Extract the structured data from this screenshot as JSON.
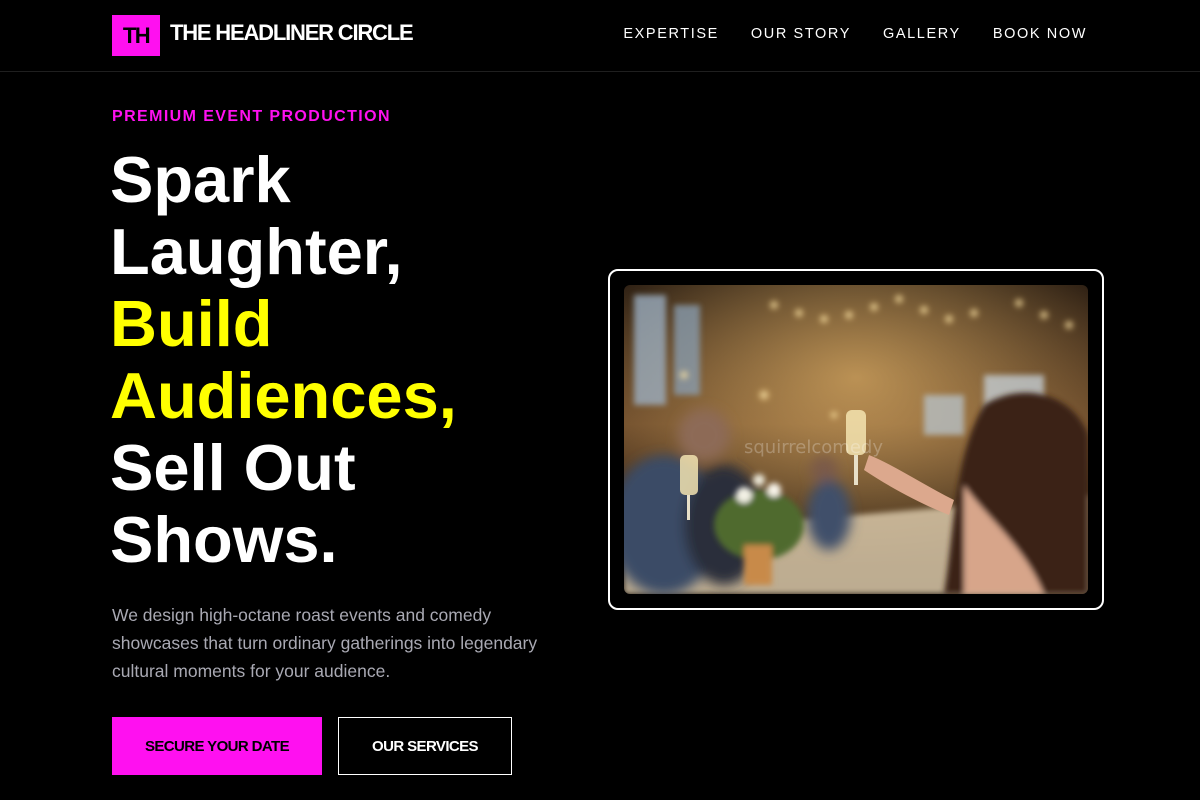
{
  "header": {
    "logo_mark": "TH",
    "brand_name": "THE HEADLINER CIRCLE",
    "nav": [
      {
        "label": "EXPERTISE"
      },
      {
        "label": "OUR STORY"
      },
      {
        "label": "GALLERY"
      },
      {
        "label": "BOOK NOW"
      }
    ]
  },
  "hero": {
    "eyebrow": "PREMIUM EVENT PRODUCTION",
    "headline_lines": [
      {
        "text": "Spark",
        "color": "#ffffff"
      },
      {
        "text": "Laughter,",
        "color": "#ffffff"
      },
      {
        "text": "Build",
        "color": "#ffff00"
      },
      {
        "text": "Audiences,",
        "color": "#ffff00"
      },
      {
        "text": "Sell Out",
        "color": "#ffffff"
      },
      {
        "text": "Shows.",
        "color": "#ffffff"
      }
    ],
    "lead": "We design high-octane roast events and comedy showcases that turn ordinary gatherings into legendary cultural moments for your audience.",
    "primary_cta": "SECURE YOUR DATE",
    "secondary_cta": "OUR SERVICES",
    "image_watermark": "squirrelcomedy"
  },
  "colors": {
    "accent_magenta": "#ff10f0",
    "accent_yellow": "#ffff00",
    "background": "#000000",
    "muted_text": "#a9a9b3"
  }
}
